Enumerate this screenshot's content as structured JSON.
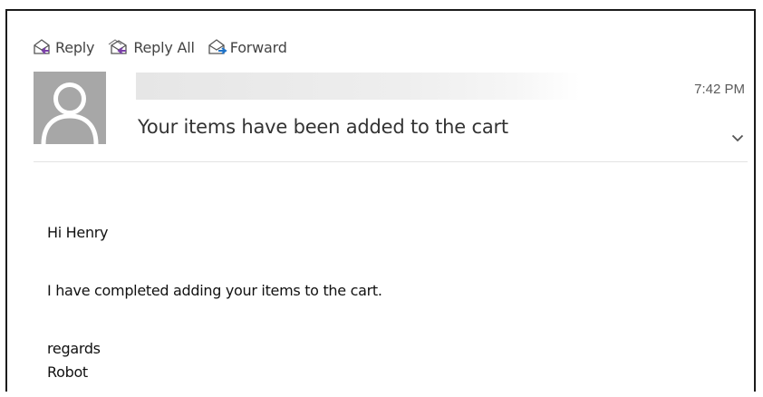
{
  "toolbar": {
    "reply_label": "Reply",
    "reply_all_label": "Reply All",
    "forward_label": "Forward"
  },
  "header": {
    "time": "7:42 PM",
    "subject": "Your items have been added to the cart"
  },
  "message": {
    "greeting": "Hi Henry",
    "body": "I have completed adding your items to the cart.",
    "closing": "regards",
    "signature": "Robot"
  },
  "colors": {
    "avatar_bg": "#a7a7a7",
    "reply_accent": "#7a3fa8",
    "forward_accent": "#1f73c9"
  },
  "icons": {
    "reply": "reply-icon",
    "reply_all": "reply-all-icon",
    "forward": "forward-icon",
    "expand": "chevron-down-icon",
    "avatar": "person-silhouette-icon"
  }
}
